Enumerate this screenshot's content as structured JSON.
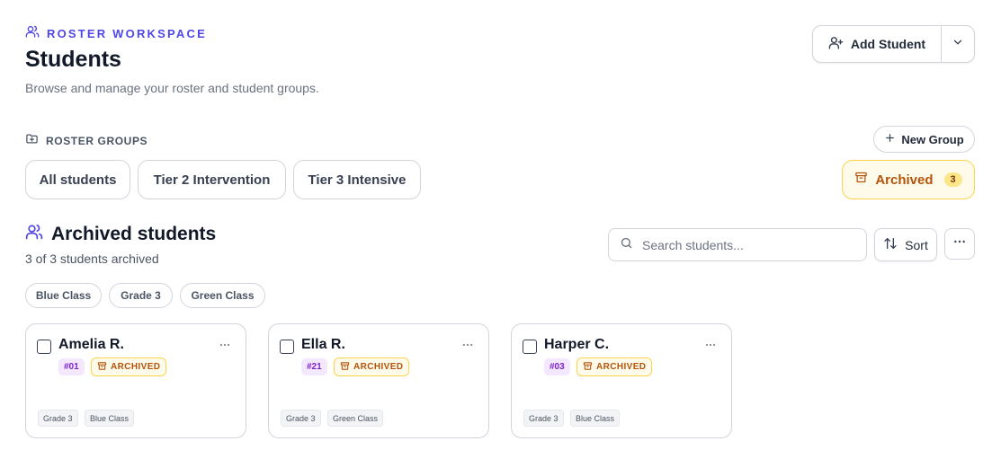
{
  "header": {
    "workspace_label": "ROSTER WORKSPACE",
    "title": "Students",
    "subtitle": "Browse and manage your roster and student groups.",
    "add_student_label": "Add Student"
  },
  "groups": {
    "section_label": "ROSTER GROUPS",
    "new_group_label": "New Group",
    "items": [
      {
        "label": "All students"
      },
      {
        "label": "Tier 2 Intervention"
      },
      {
        "label": "Tier 3 Intensive"
      }
    ],
    "archived": {
      "label": "Archived",
      "count": "3"
    }
  },
  "section": {
    "title": "Archived students",
    "subtitle": "3 of 3 students archived"
  },
  "toolbar": {
    "search_placeholder": "Search students...",
    "sort_label": "Sort"
  },
  "filters": [
    "Blue Class",
    "Grade 3",
    "Green Class"
  ],
  "students": [
    {
      "name": "Amelia R.",
      "number": "#01",
      "status": "ARCHIVED",
      "tags": [
        "Grade 3",
        "Blue Class"
      ]
    },
    {
      "name": "Ella R.",
      "number": "#21",
      "status": "ARCHIVED",
      "tags": [
        "Grade 3",
        "Green Class"
      ]
    },
    {
      "name": "Harper C.",
      "number": "#03",
      "status": "ARCHIVED",
      "tags": [
        "Grade 3",
        "Blue Class"
      ]
    }
  ],
  "colors": {
    "accent": "#4f46e5",
    "archived": "#b45309",
    "archived_bg": "#fffbeb",
    "number_badge": "#7e22ce"
  }
}
